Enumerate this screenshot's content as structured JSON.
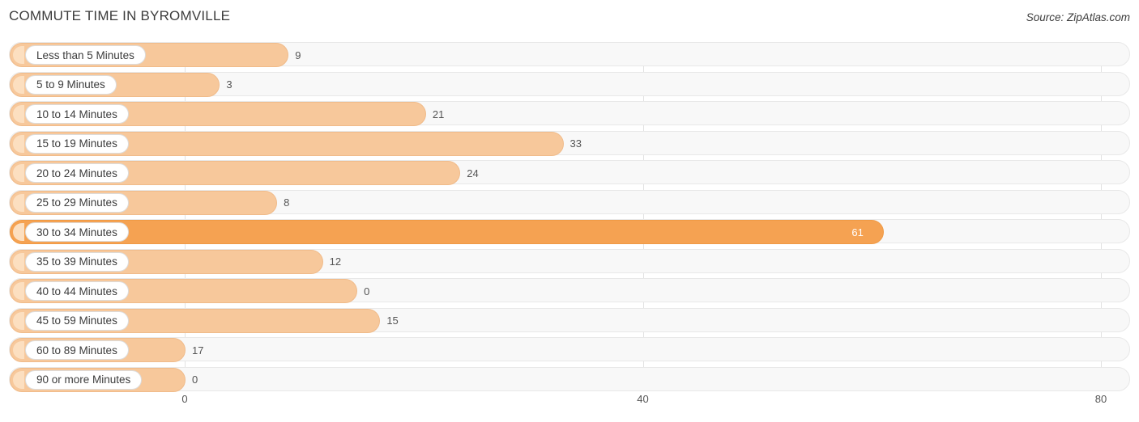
{
  "header": {
    "title": "COMMUTE TIME IN BYROMVILLE",
    "source": "Source: ZipAtlas.com"
  },
  "chart_data": {
    "type": "bar",
    "orientation": "horizontal",
    "title": "COMMUTE TIME IN BYROMVILLE",
    "xlabel": "",
    "ylabel": "",
    "xlim": [
      0,
      80
    ],
    "ticks": [
      0,
      40,
      80
    ],
    "grid": true,
    "legend": null,
    "categories": [
      "Less than 5 Minutes",
      "5 to 9 Minutes",
      "10 to 14 Minutes",
      "15 to 19 Minutes",
      "20 to 24 Minutes",
      "25 to 29 Minutes",
      "30 to 34 Minutes",
      "35 to 39 Minutes",
      "40 to 44 Minutes",
      "45 to 59 Minutes",
      "60 to 89 Minutes",
      "90 or more Minutes"
    ],
    "values": [
      9,
      3,
      21,
      33,
      24,
      8,
      61,
      12,
      15,
      17,
      0,
      0
    ],
    "value_labels": [
      "9",
      "3",
      "21",
      "33",
      "24",
      "8",
      "61",
      "12",
      "0",
      "15",
      "17",
      "0"
    ],
    "highlight_index": 6,
    "colors": {
      "bar": "#f7c89b",
      "bar_highlight": "#f5a252",
      "row_background": "#f8f8f8",
      "gridline": "#e2e2e2",
      "text": "#3c3c3c"
    }
  },
  "rows": [
    {
      "label": "Less than 5 Minutes",
      "value": "9"
    },
    {
      "label": "5 to 9 Minutes",
      "value": "3"
    },
    {
      "label": "10 to 14 Minutes",
      "value": "21"
    },
    {
      "label": "15 to 19 Minutes",
      "value": "33"
    },
    {
      "label": "20 to 24 Minutes",
      "value": "24"
    },
    {
      "label": "25 to 29 Minutes",
      "value": "8"
    },
    {
      "label": "30 to 34 Minutes",
      "value": "61"
    },
    {
      "label": "35 to 39 Minutes",
      "value": "12"
    },
    {
      "label": "40 to 44 Minutes",
      "value": "0"
    },
    {
      "label": "45 to 59 Minutes",
      "value": "15"
    },
    {
      "label": "60 to 89 Minutes",
      "value": "17"
    },
    {
      "label": "90 or more Minutes",
      "value": "0"
    }
  ],
  "axis": {
    "ticks": [
      "0",
      "40",
      "80"
    ]
  }
}
